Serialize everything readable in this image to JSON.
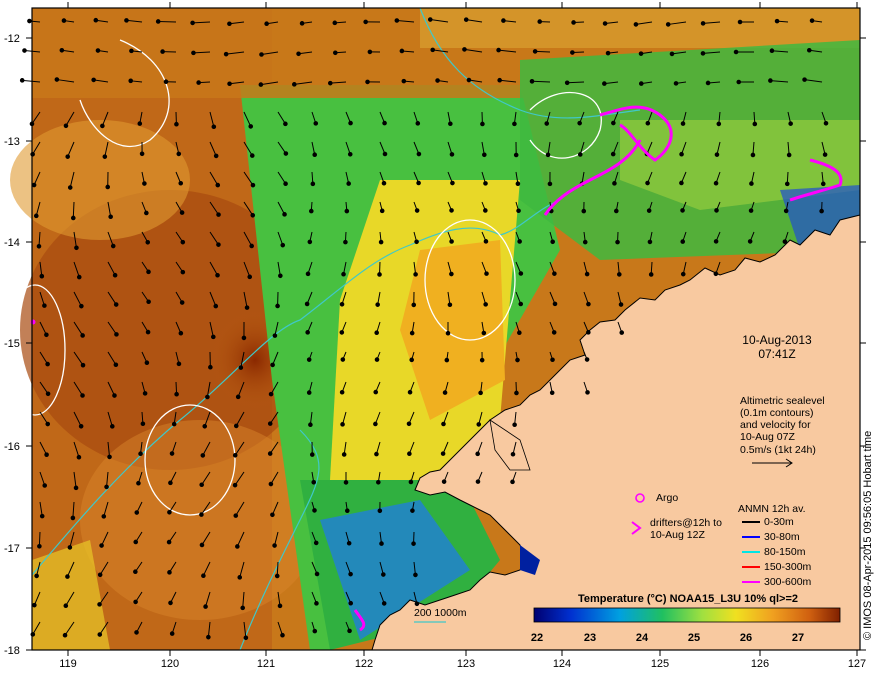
{
  "map": {
    "lon_ticks": [
      "119",
      "120",
      "121",
      "122",
      "123",
      "124",
      "125",
      "126",
      "127"
    ],
    "lat_ticks": [
      "-12",
      "-13",
      "-14",
      "-15",
      "-16",
      "-17",
      "-18"
    ],
    "date": "10-Aug-2013",
    "time": "07:41Z",
    "altimetry_note": [
      "Altimetric sealevel",
      "(0.1m contours)",
      "and velocity for",
      "10-Aug 07Z",
      "0.5m/s (1kt 24h)"
    ],
    "argo_label": "Argo",
    "drifters_label": [
      "drifters@12h to",
      "10-Aug 12Z"
    ],
    "anmn_title": "ANMN 12h av.",
    "anmn_legend": [
      {
        "label": "0-30m",
        "color": "#000000"
      },
      {
        "label": "30-80m",
        "color": "#0000ff"
      },
      {
        "label": "80-150m",
        "color": "#00e5e5"
      },
      {
        "label": "150-300m",
        "color": "#ff0000"
      },
      {
        "label": "300-600m",
        "color": "#ff00ff"
      }
    ],
    "isobath_label": "200  1000m",
    "colorbar_title": "Temperature (°C) NOAA15_L3U 10% ql>=2",
    "colorbar_ticks": [
      "22",
      "23",
      "24",
      "25",
      "26",
      "27"
    ],
    "credit": "© IMOS 08-Apr-2015 09:56:05 Hobart time",
    "colors": {
      "land": "#f8c9a0",
      "warm": "#b85a10",
      "mid": "#f0c020",
      "cool": "#30c040",
      "drifter": "#ff00ff",
      "isobath": "#40c8c8"
    }
  }
}
